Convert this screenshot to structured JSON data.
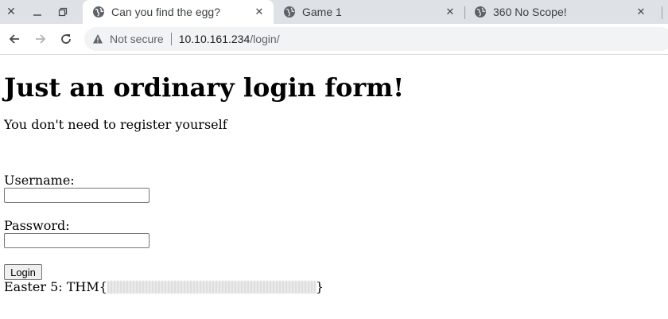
{
  "browser": {
    "tabs": [
      {
        "title": "Can you find the egg?",
        "active": true
      },
      {
        "title": "Game 1",
        "active": false
      },
      {
        "title": "360 No Scope!",
        "active": false
      }
    ],
    "omnibox": {
      "security_label": "Not secure",
      "url_host": "10.10.161.234",
      "url_path": "/login/"
    }
  },
  "page": {
    "heading": "Just an ordinary login form!",
    "subtitle": "You don't need to register yourself",
    "username_label": "Username:",
    "password_label": "Password:",
    "username_value": "",
    "password_value": "",
    "login_label": "Login",
    "easter_prefix": "Easter 5: THM{",
    "easter_suffix": "}"
  },
  "colors": {
    "tabstrip_bg": "#dee1e6",
    "omnibox_bg": "#f1f3f4"
  },
  "icons": [
    "close-icon",
    "minimize-icon",
    "restore-icon",
    "globe-icon",
    "back-arrow-icon",
    "forward-arrow-icon",
    "reload-icon",
    "warning-icon"
  ]
}
